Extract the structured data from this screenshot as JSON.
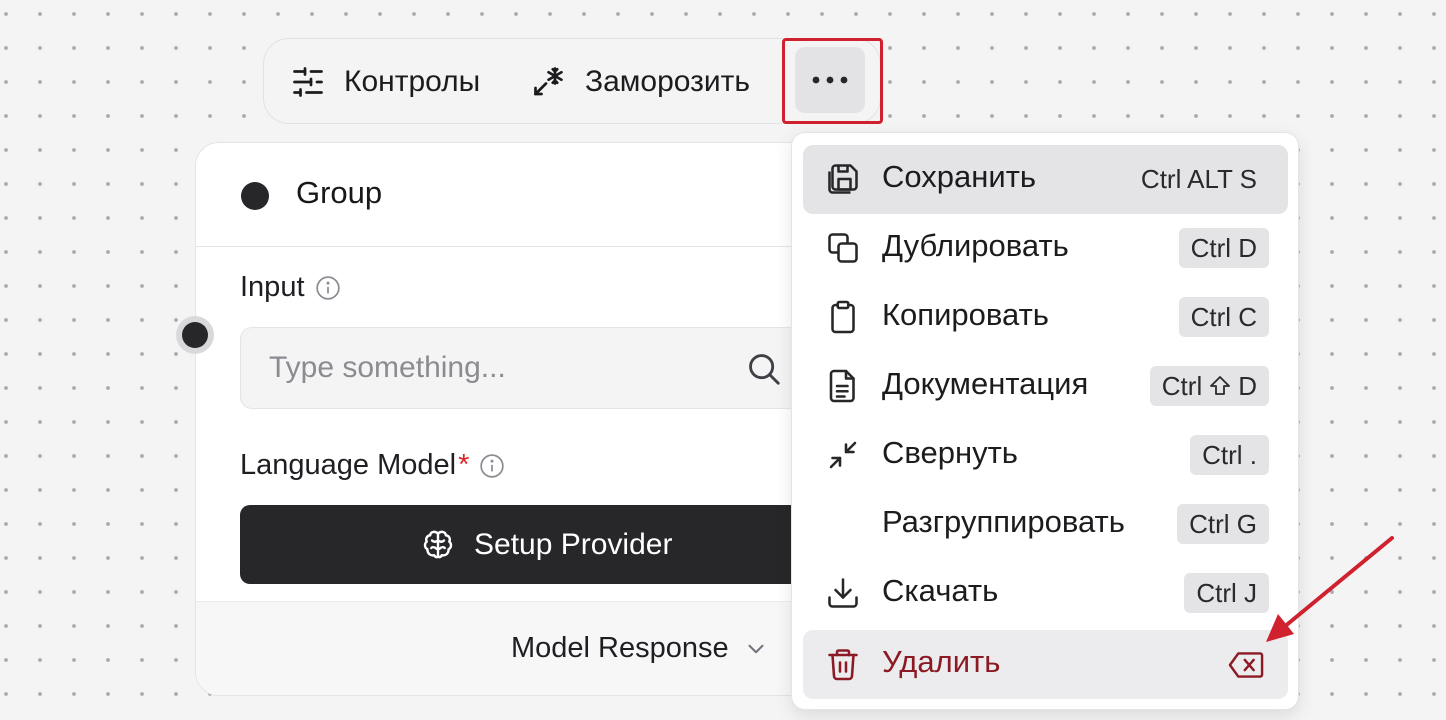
{
  "toolbar": {
    "controls_label": "Контролы",
    "freeze_label": "Заморозить",
    "more_icon": "ellipsis-icon",
    "highlight_color": "#d0212e"
  },
  "node": {
    "title": "Group",
    "input": {
      "label": "Input",
      "placeholder": "Type something..."
    },
    "model": {
      "label": "Language Model",
      "required_mark": "*",
      "button_label": "Setup Provider"
    },
    "footer_label": "Model Response"
  },
  "menu": {
    "items": [
      {
        "label": "Сохранить",
        "shortcut": "Ctrl ALT S",
        "icon": "save-icon"
      },
      {
        "label": "Дублировать",
        "shortcut": "Ctrl D",
        "icon": "duplicate-icon"
      },
      {
        "label": "Копировать",
        "shortcut": "Ctrl C",
        "icon": "clipboard-icon"
      },
      {
        "label": "Документация",
        "shortcut_prefix": "Ctrl",
        "shortcut_suffix": "D",
        "icon": "document-icon"
      },
      {
        "label": "Свернуть",
        "shortcut": "Ctrl .",
        "icon": "minimize-icon"
      },
      {
        "label": "Разгруппировать",
        "shortcut": "Ctrl G"
      },
      {
        "label": "Скачать",
        "shortcut": "Ctrl J",
        "icon": "download-icon"
      },
      {
        "label": "Удалить",
        "icon": "trash-icon",
        "shortcut_icon": "backspace-icon",
        "color": "#8b1a24"
      }
    ]
  },
  "annotation": {
    "arrow_color": "#d0212e"
  }
}
